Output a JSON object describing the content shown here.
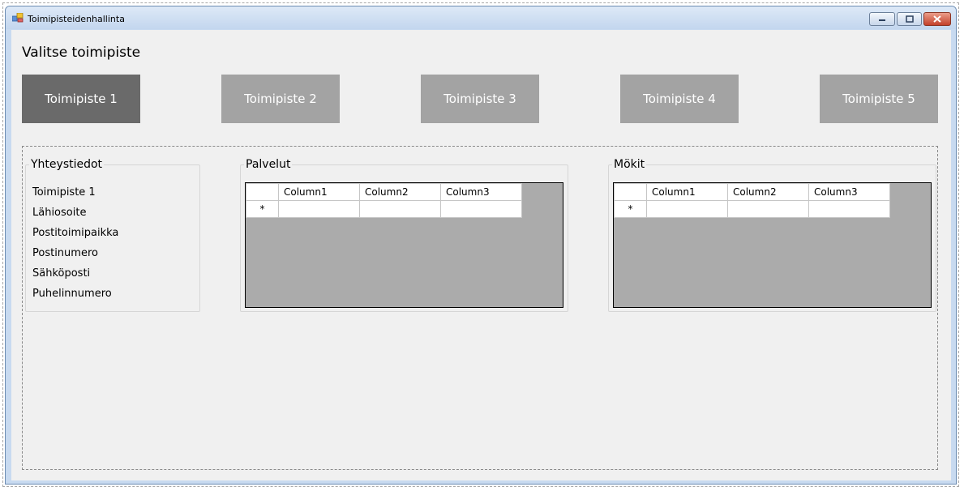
{
  "window": {
    "title": "Toimipisteidenhallinta"
  },
  "heading": "Valitse toimipiste",
  "offices": [
    {
      "label": "Toimipiste 1",
      "active": true
    },
    {
      "label": "Toimipiste 2",
      "active": false
    },
    {
      "label": "Toimipiste 3",
      "active": false
    },
    {
      "label": "Toimipiste 4",
      "active": false
    },
    {
      "label": "Toimipiste 5",
      "active": false
    }
  ],
  "contact": {
    "legend": "Yhteystiedot",
    "fields": [
      "Toimipiste 1",
      "Lähiosoite",
      "Postitoimipaikka",
      "Postinumero",
      "Sähköposti",
      "Puhelinnumero"
    ]
  },
  "services": {
    "legend": "Palvelut",
    "columns": [
      "Column1",
      "Column2",
      "Column3"
    ],
    "new_row_marker": "*"
  },
  "cabins": {
    "legend": "Mökit",
    "columns": [
      "Column1",
      "Column2",
      "Column3"
    ],
    "new_row_marker": "*"
  },
  "colors": {
    "active_button": "#6a6a6a",
    "inactive_button": "#a3a3a3",
    "grid_background": "#ababab"
  }
}
